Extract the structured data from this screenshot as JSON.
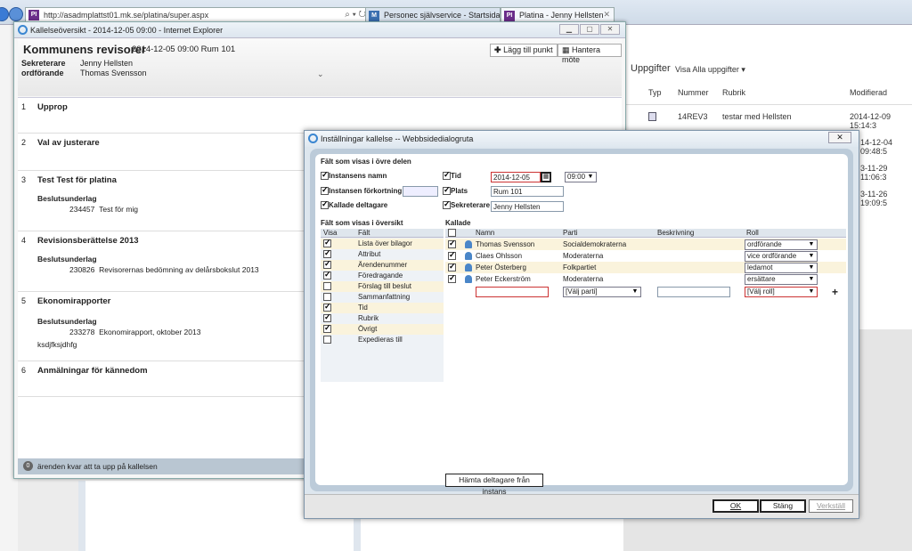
{
  "browser": {
    "url": "http://asadmplattst01.mk.se/platina/super.aspx",
    "tabs": [
      {
        "label": "Personec självservice - Startsida",
        "icon": "M"
      },
      {
        "label": "Platina - Jenny Hellsten",
        "icon": "PI"
      }
    ],
    "favicon": "PI"
  },
  "background_page": {
    "title": "Uppgifter",
    "filter": "Visa Alla uppgifter",
    "columns": [
      "Typ",
      "Nummer",
      "Rubrik",
      "Modifierad"
    ],
    "rows": [
      {
        "nummer": "14REV3",
        "rubrik": "testar med Hellsten",
        "modifierad": "2014-12-09 15:14:3"
      },
      {
        "modifierad": "14-12-04 09:48:5"
      },
      {
        "modifierad": "3-11-29 11:06:3"
      },
      {
        "modifierad": "3-11-26 19:09:5"
      }
    ]
  },
  "main_window": {
    "title": "Kallelseöversikt - 2014-12-05 09:00 - Internet Explorer",
    "meeting_title": "Kommunens revisorer",
    "meeting_info": "2014-12-05 09:00 Rum 101",
    "add_point_label": "Lägg till punkt",
    "manage_label": "Hantera möte",
    "roles": [
      {
        "role": "Sekreterare",
        "name": "Jenny Hellsten"
      },
      {
        "role": "ordförande",
        "name": "Thomas Svensson"
      }
    ],
    "agenda": [
      {
        "num": "1",
        "title": "Upprop"
      },
      {
        "num": "2",
        "title": "Val av justerare"
      },
      {
        "num": "3",
        "title": "Test Test för platina",
        "sub": "Beslutsunderlag",
        "ref_no": "234457",
        "ref_text": "Test för mig"
      },
      {
        "num": "4",
        "title": "Revisionsberättelse 2013",
        "sub": "Beslutsunderlag",
        "ref_no": "230826",
        "ref_text": "Revisorernas bedömning av delårsbokslut 2013"
      },
      {
        "num": "5",
        "title": "Ekonomirapporter",
        "sub": "Beslutsunderlag",
        "ref_no": "233278",
        "ref_text": "Ekonomirapport, oktober 2013",
        "extra": "ksdjfksjdhfg"
      },
      {
        "num": "6",
        "title": "Anmälningar för kännedom"
      }
    ],
    "status_count": "0",
    "status_text": "ärenden kvar att ta upp på kallelsen"
  },
  "dialog": {
    "title": "Inställningar kallelse -- Webbsidedialogruta",
    "upper_section_label": "Fält som visas i övre delen",
    "upper_checks": [
      {
        "label": "Instansens namn",
        "checked": true
      },
      {
        "label": "Instansen förkortning",
        "checked": true
      },
      {
        "label": "Kallade deltagare",
        "checked": true
      }
    ],
    "tid_label": "Tid",
    "tid_date": "2014-12-05",
    "tid_time": "09:00",
    "plats_label": "Plats",
    "plats_value": "Rum 101",
    "sekr_label": "Sekreterare",
    "sekr_value": "Jenny Hellsten",
    "overview_label": "Fält som visas i översikt",
    "overview_cols": [
      "Visa",
      "Fält"
    ],
    "overview_fields": [
      {
        "label": "Lista över bilagor",
        "checked": true
      },
      {
        "label": "Attribut",
        "checked": true
      },
      {
        "label": "Ärendenummer",
        "checked": true
      },
      {
        "label": "Föredragande",
        "checked": true
      },
      {
        "label": "Förslag till beslut",
        "checked": false
      },
      {
        "label": "Sammanfattning",
        "checked": false
      },
      {
        "label": "Tid",
        "checked": true
      },
      {
        "label": "Rubrik",
        "checked": true
      },
      {
        "label": "Övrigt",
        "checked": true
      },
      {
        "label": "Expedieras till",
        "checked": false
      }
    ],
    "kallade_label": "Kallade",
    "kallade_cols": [
      "Namn",
      "Parti",
      "Beskrivning",
      "Roll"
    ],
    "kallade": [
      {
        "name": "Thomas Svensson",
        "parti": "Socialdemokraterna",
        "roll": "ordförande"
      },
      {
        "name": "Claes Ohlsson",
        "parti": "Moderaterna",
        "roll": "vice ordförande"
      },
      {
        "name": "Peter Österberg",
        "parti": "Folkpartiet",
        "roll": "ledamot"
      },
      {
        "name": "Peter Eckerström",
        "parti": "Moderaterna",
        "roll": "ersättare"
      }
    ],
    "new_row": {
      "parti_placeholder": "[Välj parti]",
      "roll_placeholder": "[Välj roll]"
    },
    "fetch_label": "Hämta deltagare från instans",
    "ok_label": "OK",
    "close_label": "Stäng",
    "apply_label": "Verkställ"
  }
}
